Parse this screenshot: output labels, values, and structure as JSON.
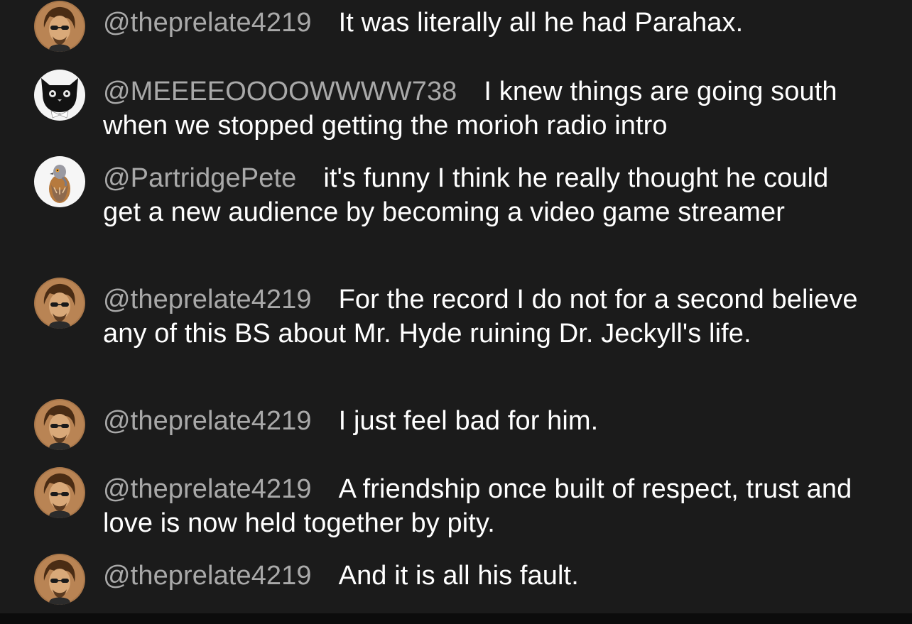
{
  "messages": [
    {
      "handle": "@theprelate4219",
      "text": "It was literally all he had Parahax.",
      "avatar": "man-sunglasses-avatar"
    },
    {
      "handle": "@MEEEEOOOOWWWW738",
      "text": "I knew things are going south when we stopped getting the morioh radio intro",
      "avatar": "cat-avatar"
    },
    {
      "handle": "@PartridgePete",
      "text": "it's funny I think he really thought he could get a new audience by becoming a video game streamer",
      "avatar": "partridge-avatar"
    },
    {
      "handle": "@theprelate4219",
      "text": "For the record I do not for a second believe any of this BS about Mr. Hyde ruining Dr. Jeckyll's life.",
      "avatar": "man-sunglasses-avatar"
    },
    {
      "handle": "@theprelate4219",
      "text": "I just feel bad for him.",
      "avatar": "man-sunglasses-avatar"
    },
    {
      "handle": "@theprelate4219",
      "text": "A friendship once built of respect, trust and love is now held together by pity.",
      "avatar": "man-sunglasses-avatar"
    },
    {
      "handle": "@theprelate4219",
      "text": "And it is all his fault.",
      "avatar": "man-sunglasses-avatar"
    }
  ],
  "colors": {
    "background": "#1b1b1b",
    "handle": "#a9a9a9",
    "text": "#ffffff"
  }
}
